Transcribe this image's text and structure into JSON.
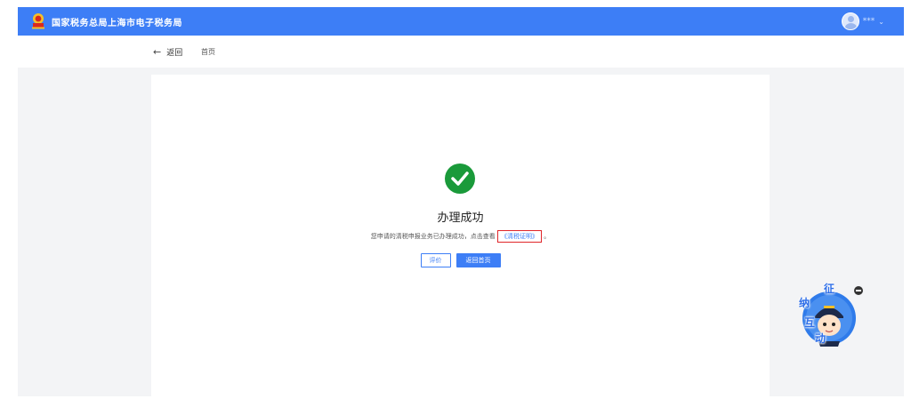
{
  "header": {
    "site_title": "国家税务总局上海市电子税务局",
    "username": "***",
    "emblem_icon": "tax-emblem-icon"
  },
  "nav": {
    "back_label": "返回",
    "home_label": "首页"
  },
  "result": {
    "status_icon": "check-circle-icon",
    "title": "办理成功",
    "description_prefix": "您申请的清税申报业务已办理成功，点击查看",
    "proof_link": "《清税证明》",
    "description_suffix": "。",
    "evaluate_button": "评价",
    "home_button": "返回首页"
  },
  "assistant": {
    "chars": [
      "征",
      "纳",
      "互",
      "动"
    ],
    "icon": "tax-officer-mascot-icon"
  },
  "colors": {
    "brand": "#3d7ef6",
    "success": "#1a9a3a",
    "highlight_border": "#e0262a"
  }
}
